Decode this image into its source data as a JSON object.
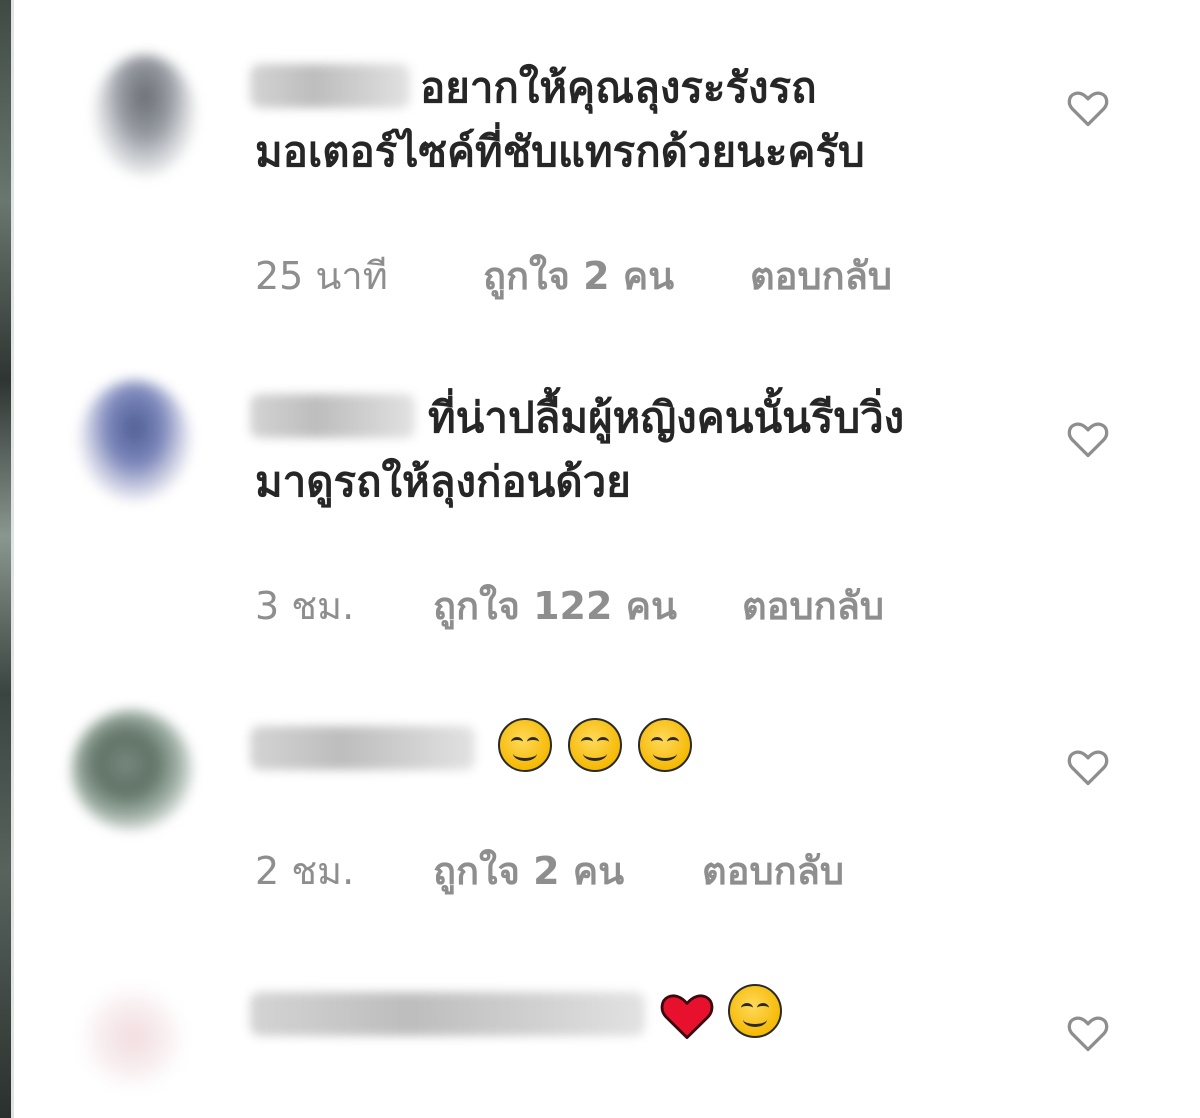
{
  "comments": [
    {
      "lines": [
        "อยากให้คุณลุงระรังรถ",
        "มอเตอร์ไซค์ที่ชับแทรกด้วยนะครับ"
      ],
      "time": "25 นาที",
      "likes": "ถูกใจ 2 คน",
      "reply": "ตอบกลับ"
    },
    {
      "lines": [
        "ที่น่าปลื้มผู้หญิงคนนั้นรีบวิ่ง",
        "มาดูรถให้ลุงก่อนด้วย"
      ],
      "time": "3 ชม.",
      "likes": "ถูกใจ 122 คน",
      "reply": "ตอบกลับ"
    },
    {
      "emojis": [
        "smiling-face",
        "smiling-face",
        "smiling-face"
      ],
      "time": "2 ชม.",
      "likes": "ถูกใจ 2 คน",
      "reply": "ตอบกลับ"
    },
    {
      "emojis": [
        "red-heart",
        "smiling-face"
      ]
    }
  ],
  "colors": {
    "text": "#262626",
    "meta": "#8e8e8e",
    "heart_outline": "#8e8e8e",
    "red_heart": "#e8112d",
    "emoji_yellow": "#f5b800"
  },
  "icons": {
    "like": "heart-outline-icon"
  }
}
